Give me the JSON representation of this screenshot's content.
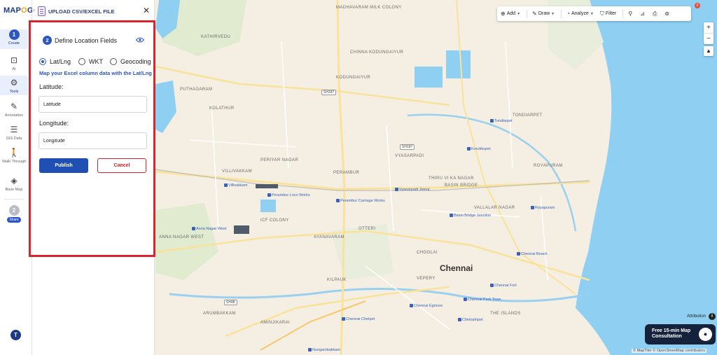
{
  "app": {
    "logo_prefix": "MAP",
    "logo_accent": "O",
    "logo_suffix": "G"
  },
  "rail": {
    "create": {
      "number": "1",
      "label": "Create"
    },
    "ai": "AI",
    "tools": "Tools",
    "annotation": "Annotation",
    "gis_data": "GIS Data",
    "walk_through": "Walk Through",
    "base_map": "Base Map",
    "share": {
      "number": "2",
      "label": "Share"
    },
    "user_initial": "T"
  },
  "panel": {
    "title": "UPLOAD CSV/EXCEL FILE",
    "step_number": "2",
    "step_title": "Define Location Fields",
    "radios": [
      {
        "label": "Lat/Lng",
        "checked": true
      },
      {
        "label": "WKT",
        "checked": false
      },
      {
        "label": "Geocoding",
        "checked": false
      }
    ],
    "hint": "Map your Excel column data with the Lat/Lng",
    "latitude_label": "Latitude:",
    "latitude_value": "Latitude",
    "longitude_label": "Longitude:",
    "longitude_value": "Longitude",
    "publish_label": "Publish",
    "cancel_label": "Cancel"
  },
  "toolbar": {
    "add": "Add",
    "draw": "Draw",
    "analyze": "Analyze",
    "filter": "Filter",
    "notification_count": "0"
  },
  "map": {
    "city": "Chennai",
    "areas": [
      "MADHAVARAM MILK COLONY",
      "KATHIRVEDU",
      "CHINNA KODUNGAIYUR",
      "KODUNGAIYUR",
      "PUTHAGARAM",
      "KOLATHUR",
      "TONDIARPET",
      "PERIYAR NAGAR",
      "VYASARPADI",
      "VILLIVAKKAM",
      "PERAMBUR",
      "THIRU VI KA NAGAR",
      "ROYAPURAM",
      "BASIN BRIDGE",
      "VALLALAR NAGAR",
      "ANNA NAGAR WEST",
      "ICF COLONY",
      "OTTERI",
      "AYANAVARAM",
      "CHOOLAI",
      "KILPAUK",
      "VEPERY",
      "ARUMBAKKAM",
      "AMINJIKARAI",
      "THE ISLANDS"
    ],
    "stations": [
      "Tondiarpet",
      "Korukkupet",
      "Villivakkam",
      "Perambur Loco Works",
      "Perambur Carriage Works",
      "Vyasarpadi Jeeva",
      "Royapuram",
      "Basin Bridge Junction",
      "Anna Nagar West",
      "Chennai Beach",
      "Chennai Fort",
      "Chennai Park Town",
      "Chennai Egmore",
      "Chennai Chetpet",
      "Chintadripet",
      "Nungambakkam"
    ],
    "shields": [
      "SH187",
      "SH187",
      "SH48"
    ],
    "attribution": "Attribution",
    "consult_line1": "Free 15-min Map",
    "consult_line2": "Consultation",
    "credits": "© MapTiler © OpenStreetMap contributors"
  }
}
